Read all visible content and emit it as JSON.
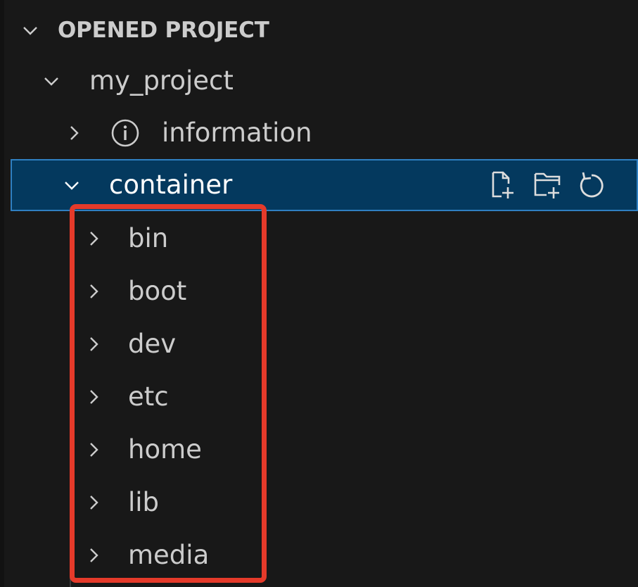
{
  "section": {
    "title": "OPENED PROJECT",
    "expanded": true
  },
  "tree": {
    "project": {
      "label": "my_project",
      "expanded": true
    },
    "information": {
      "label": "information",
      "expanded": false,
      "icon": "info-icon"
    },
    "container": {
      "label": "container",
      "expanded": true,
      "selected": true,
      "actions": [
        {
          "name": "new-file-icon",
          "title": "New File"
        },
        {
          "name": "new-folder-icon",
          "title": "New Folder"
        },
        {
          "name": "refresh-icon",
          "title": "Refresh"
        }
      ],
      "children": [
        {
          "label": "bin"
        },
        {
          "label": "boot"
        },
        {
          "label": "dev"
        },
        {
          "label": "etc"
        },
        {
          "label": "home"
        },
        {
          "label": "lib"
        },
        {
          "label": "media"
        }
      ]
    }
  },
  "colors": {
    "background": "#181818",
    "selection_background": "#04395e",
    "selection_border": "#2f7fc1",
    "highlight_annotation": "#e53a2a",
    "text": "#cccccc"
  }
}
